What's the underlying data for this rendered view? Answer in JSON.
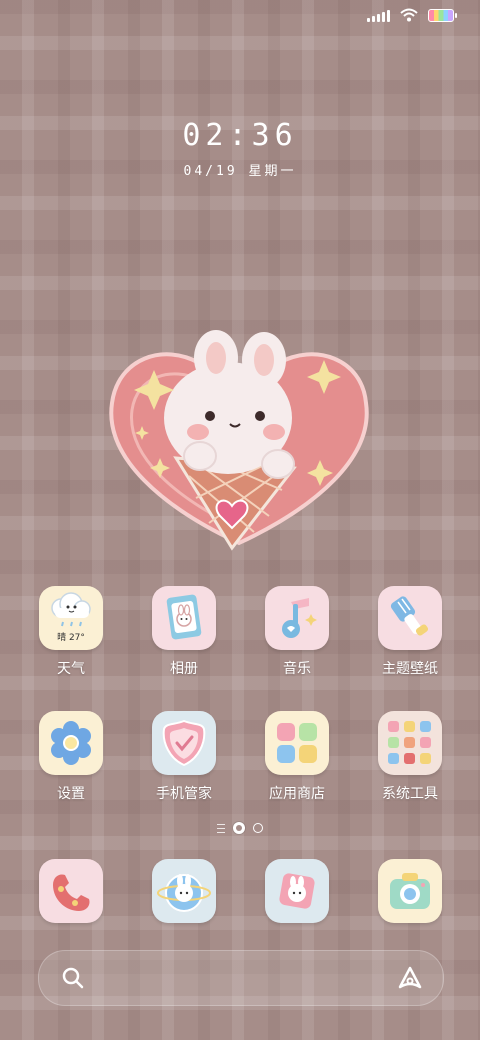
{
  "colors": {
    "wallpaper": "#a68d89",
    "tile_pink": "#f7dde2",
    "tile_cream": "#fbf0d4",
    "tile_blue": "#dde9ef",
    "text": "#ffffff"
  },
  "status_bar": {
    "signal_icon": "signal-bars-icon",
    "wifi_icon": "wifi-icon",
    "battery_icon": "rainbow-battery-icon"
  },
  "clock": {
    "time": "02:36",
    "date": "04/19 星期一"
  },
  "wallpaper_art": "bunny-in-ice-cream-cone-heart",
  "apps_row1": [
    {
      "label": "天气",
      "icon": "weather-cloud-icon",
      "badge": "晴 27°"
    },
    {
      "label": "相册",
      "icon": "photo-album-bunny-icon"
    },
    {
      "label": "音乐",
      "icon": "music-note-icon"
    },
    {
      "label": "主题壁纸",
      "icon": "paint-brush-icon"
    }
  ],
  "apps_row2": [
    {
      "label": "设置",
      "icon": "gear-flower-icon"
    },
    {
      "label": "手机管家",
      "icon": "shield-check-icon"
    },
    {
      "label": "应用商店",
      "icon": "app-store-grid-icon"
    },
    {
      "label": "系统工具",
      "icon": "system-tools-folder-icon"
    }
  ],
  "dock": [
    {
      "icon": "phone-icon"
    },
    {
      "icon": "browser-bunny-icon"
    },
    {
      "icon": "messages-bunny-icon"
    },
    {
      "icon": "camera-icon"
    }
  ],
  "search": {
    "left_icon": "search-icon",
    "right_icon": "assistant-icon"
  },
  "page_indicator": {
    "pages": 2,
    "active": 1
  }
}
